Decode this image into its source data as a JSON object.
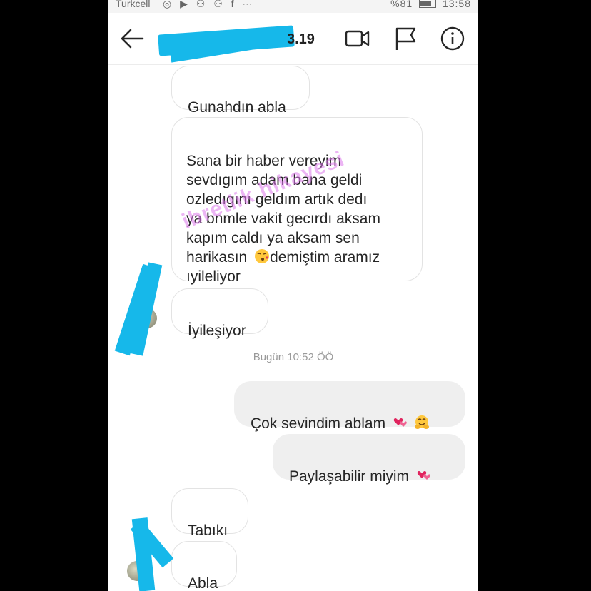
{
  "status_bar": {
    "carrier": "Turkcell",
    "left_icons": "◎ ▶ ⚇ ⚇ f ⋯",
    "signal": "📶",
    "battery_text": "%81",
    "time": "13:58"
  },
  "header": {
    "title_suffix": "3.19"
  },
  "messages": [
    {
      "text": "Gunahdın abla"
    },
    {
      "text": "Sana bir haber vereyim\nsevdıgım adam bana geldi\nozledıgını geldım artık dedı\nya bnmle vakit gecırdı aksam\nkapım caldı ya aksam sen\nharikasın ",
      "text_after": "demiştim aramız\nıyileliyor"
    },
    {
      "text": "İyileşiyor"
    },
    {
      "text": "Çok sevindim ablam "
    },
    {
      "text": "Paylaşabilir miyim "
    },
    {
      "text": "Tabıkı"
    },
    {
      "text": "Abla"
    }
  ],
  "timestamp": "Bugün 10:52 ÖÖ",
  "watermark": "ibretlik hikayesi",
  "colors": {
    "redaction": "#16b8ea",
    "sent_bubble": "#efefef",
    "received_border": "#e3e3e3"
  }
}
